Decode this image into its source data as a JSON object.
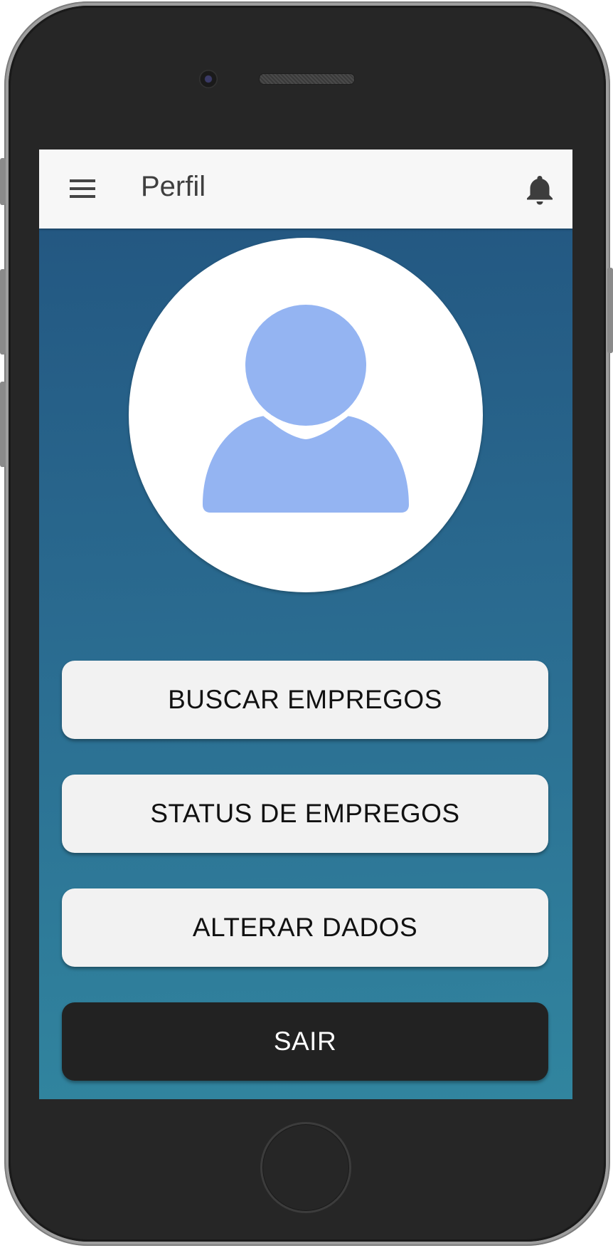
{
  "appbar": {
    "title": "Perfil",
    "menu_icon": "hamburger-menu-icon",
    "notification_icon": "bell-icon"
  },
  "profile": {
    "avatar_icon": "user-silhouette-icon"
  },
  "actions": {
    "buscar_label": "BUSCAR EMPREGOS",
    "status_label": "STATUS DE EMPREGOS",
    "alterar_label": "ALTERAR DADOS",
    "sair_label": "SAIR"
  },
  "colors": {
    "appbar_bg": "#f7f7f7",
    "screen_gradient_top": "#22547f",
    "screen_gradient_bottom": "#31859f",
    "avatar_fill": "#94b4f2",
    "button_bg": "#f2f2f2",
    "logout_button_bg": "#222222"
  }
}
